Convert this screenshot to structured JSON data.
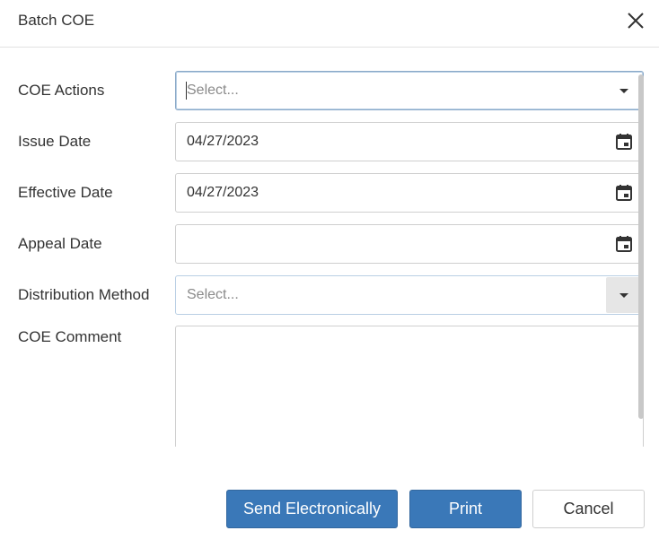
{
  "dialog": {
    "title": "Batch COE"
  },
  "form": {
    "coe_actions": {
      "label": "COE Actions",
      "placeholder": "Select..."
    },
    "issue_date": {
      "label": "Issue Date",
      "value": "04/27/2023"
    },
    "effective_date": {
      "label": "Effective Date",
      "value": "04/27/2023"
    },
    "appeal_date": {
      "label": "Appeal Date",
      "value": ""
    },
    "distribution_method": {
      "label": "Distribution Method",
      "placeholder": "Select..."
    },
    "coe_comment": {
      "label": "COE Comment",
      "value": ""
    }
  },
  "footer": {
    "send_label": "Send Electronically",
    "print_label": "Print",
    "cancel_label": "Cancel"
  },
  "colors": {
    "primary": "#3a78b8",
    "focus_border": "#8aa9c8"
  },
  "icons": {
    "close": "close-icon",
    "calendar": "calendar-icon",
    "dropdown": "chevron-down-icon"
  }
}
